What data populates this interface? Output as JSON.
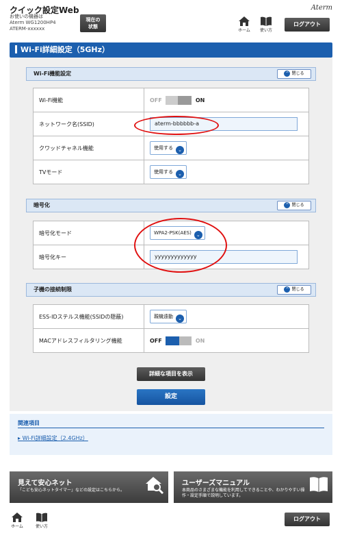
{
  "header": {
    "app_title": "クイック設定Web",
    "device_label": "お使いの機器は",
    "device_model": "Aterm WG1200HP4",
    "device_id": "ATERM-xxxxxx",
    "status_button": [
      "現在の",
      "状態"
    ],
    "brand": "Aterm",
    "nav": {
      "home": "ホーム",
      "manual": "使い方"
    },
    "logout": "ログアウト"
  },
  "page": {
    "title": "Wi-Fi詳細設定（5GHz）"
  },
  "sections": [
    {
      "title": "Wi-Fi機能設定",
      "close_label": "閉じる",
      "rows": [
        {
          "label": "Wi-Fi機能",
          "type": "toggle",
          "off": "OFF",
          "on": "ON",
          "state": "on"
        },
        {
          "label": "ネットワーク名(SSID)",
          "type": "text",
          "value": "aterm-bbbbbb-a"
        },
        {
          "label": "クワッドチャネル機能",
          "type": "select",
          "value": "使用する"
        },
        {
          "label": "TVモード",
          "type": "select",
          "value": "使用する"
        }
      ]
    },
    {
      "title": "暗号化",
      "close_label": "閉じる",
      "rows": [
        {
          "label": "暗号化モード",
          "type": "select",
          "value": "WPA2-PSK(AES)"
        },
        {
          "label": "暗号化キー",
          "type": "text",
          "value": "yyyyyyyyyyyyy"
        }
      ]
    },
    {
      "title": "子機の接続制限",
      "close_label": "閉じる",
      "rows": [
        {
          "label": "ESS-IDステルス機能(SSIDの隠蔽)",
          "type": "select",
          "value": "親機遠動"
        },
        {
          "label": "MACアドレスフィルタリング機能",
          "type": "toggle",
          "off": "OFF",
          "on": "ON",
          "state": "off"
        }
      ]
    }
  ],
  "buttons": {
    "show_details": "詳細な項目を表示",
    "submit": "設定"
  },
  "related": {
    "title": "関連項目",
    "link": "Wi-Fi詳細設定（2.4GHz）"
  },
  "banners": [
    {
      "title": "見えて安心ネット",
      "desc": "「こども安心ネットタイマー」などの設定はこちらから。"
    },
    {
      "title": "ユーザーズマニュアル",
      "desc": "本商品のさまざまな機能を利用してできることや、わかりやすい操作・設定手順で説明しています。"
    }
  ],
  "colors": {
    "primary": "#1c5fae",
    "highlight": "#e01010",
    "panel": "#efefef"
  }
}
